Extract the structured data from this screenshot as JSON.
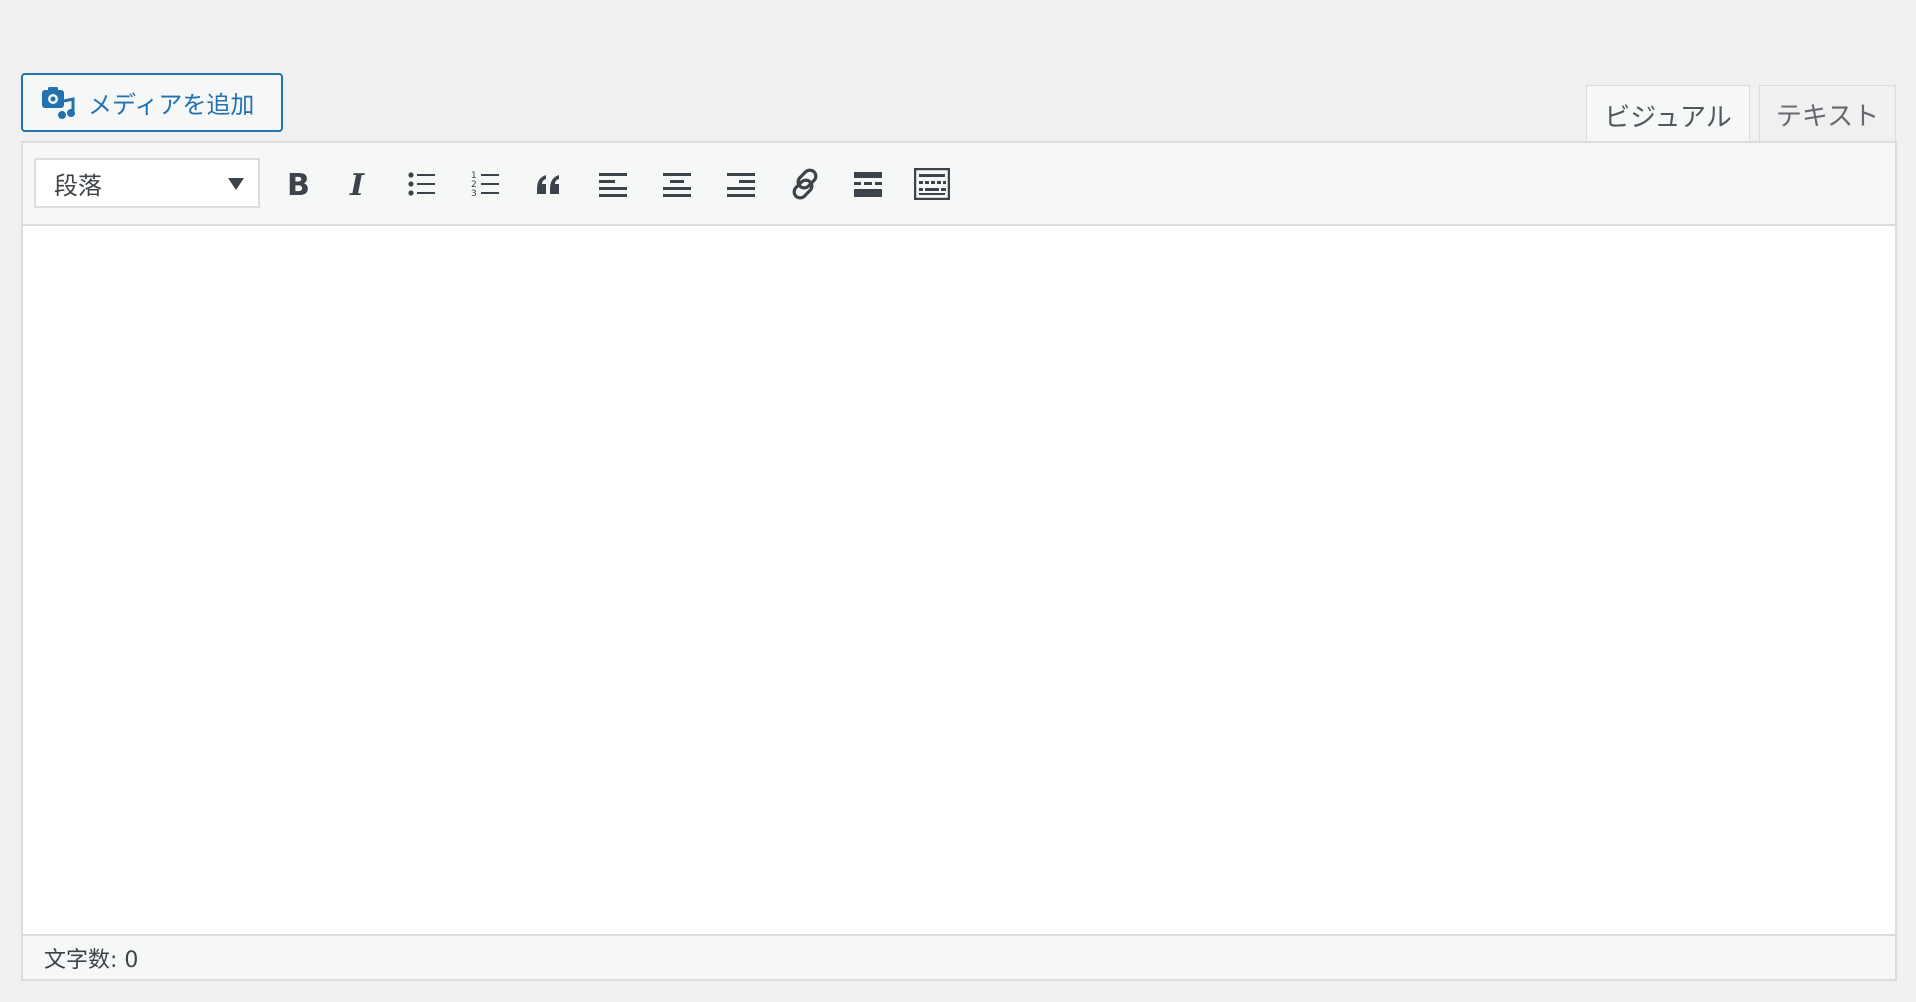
{
  "media_button": {
    "label": "メディアを追加",
    "icon": "media-add-icon"
  },
  "tabs": [
    {
      "label": "ビジュアル",
      "active": true
    },
    {
      "label": "テキスト",
      "active": false
    }
  ],
  "toolbar": {
    "format_select": {
      "selected": "段落"
    },
    "buttons": [
      "bold-icon",
      "italic-icon",
      "bulleted-list-icon",
      "numbered-list-icon",
      "blockquote-icon",
      "align-left-icon",
      "align-center-icon",
      "align-right-icon",
      "link-icon",
      "read-more-icon",
      "toolbar-toggle-icon"
    ]
  },
  "status": {
    "word_count": "文字数: 0"
  },
  "colors": {
    "accent": "#2271b1",
    "icon": "#3c434a",
    "border": "#dcdcde",
    "background": "#f0f0f1"
  }
}
